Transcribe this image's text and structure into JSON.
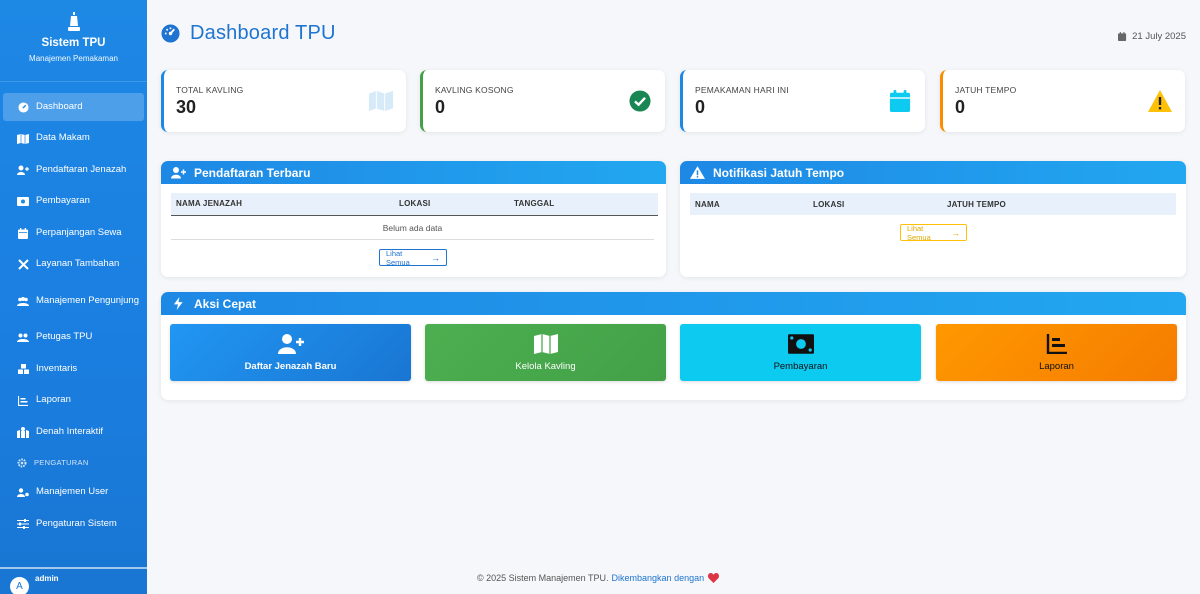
{
  "sidebar": {
    "brand_title": "Sistem TPU",
    "brand_subtitle": "Manajemen Pemakaman",
    "items": [
      {
        "label": "Dashboard",
        "icon": "gauge-icon",
        "active": true
      },
      {
        "label": "Data Makam",
        "icon": "map-icon"
      },
      {
        "label": "Pendaftaran Jenazah",
        "icon": "user-plus-icon"
      },
      {
        "label": "Pembayaran",
        "icon": "money-icon"
      },
      {
        "label": "Perpanjangan Sewa",
        "icon": "calendar-icon"
      },
      {
        "label": "Layanan Tambahan",
        "icon": "tools-icon"
      },
      {
        "label": "Manajemen Pengunjung",
        "icon": "users-icon"
      },
      {
        "label": "Petugas TPU",
        "icon": "staff-icon"
      },
      {
        "label": "Inventaris",
        "icon": "boxes-icon"
      },
      {
        "label": "Laporan",
        "icon": "chart-icon"
      },
      {
        "label": "Denah Interaktif",
        "icon": "map-marked-icon"
      }
    ],
    "section_label": "PENGATURAN",
    "settings_items": [
      {
        "label": "Manajemen User",
        "icon": "users-cog-icon"
      },
      {
        "label": "Pengaturan Sistem",
        "icon": "sliders-icon"
      }
    ],
    "user": {
      "initial": "A",
      "name": "admin"
    }
  },
  "header": {
    "title": "Dashboard TPU",
    "date": "21 July 2025"
  },
  "stats": [
    {
      "label": "TOTAL KAVLING",
      "value": "30",
      "color": "#1e88e5",
      "icon": "map-icon"
    },
    {
      "label": "KAVLING KOSONG",
      "value": "0",
      "color": "#43a047",
      "icon": "check-circle-icon"
    },
    {
      "label": "PEMAKAMAN HARI INI",
      "value": "0",
      "color": "#1e88e5",
      "icon": "calendar-icon"
    },
    {
      "label": "JATUH TEMPO",
      "value": "0",
      "color": "#fb8c00",
      "icon": "warning-icon"
    }
  ],
  "recent_registrations": {
    "title": "Pendaftaran Terbaru",
    "columns": [
      "NAMA JENAZAH",
      "LOKASI",
      "TANGGAL"
    ],
    "empty_text": "Belum ada data",
    "view_all": "Lihat Semua"
  },
  "due_notifications": {
    "title": "Notifikasi Jatuh Tempo",
    "columns": [
      "NAMA",
      "LOKASI",
      "JATUH TEMPO"
    ],
    "view_all": "Lihat Semua"
  },
  "quick_actions": {
    "title": "Aksi Cepat",
    "items": [
      {
        "label": "Daftar Jenazah Baru",
        "color": "#1e88e5",
        "icon": "user-plus-icon"
      },
      {
        "label": "Kelola Kavling",
        "color": "#43a047",
        "icon": "map-icon"
      },
      {
        "label": "Pembayaran",
        "color": "#0dcaf0",
        "icon": "money-icon"
      },
      {
        "label": "Laporan",
        "color": "#fb8c00",
        "icon": "chart-icon"
      }
    ]
  },
  "footer": {
    "text": "© 2025 Sistem Manajemen TPU.",
    "link": "Dikembangkan dengan"
  }
}
